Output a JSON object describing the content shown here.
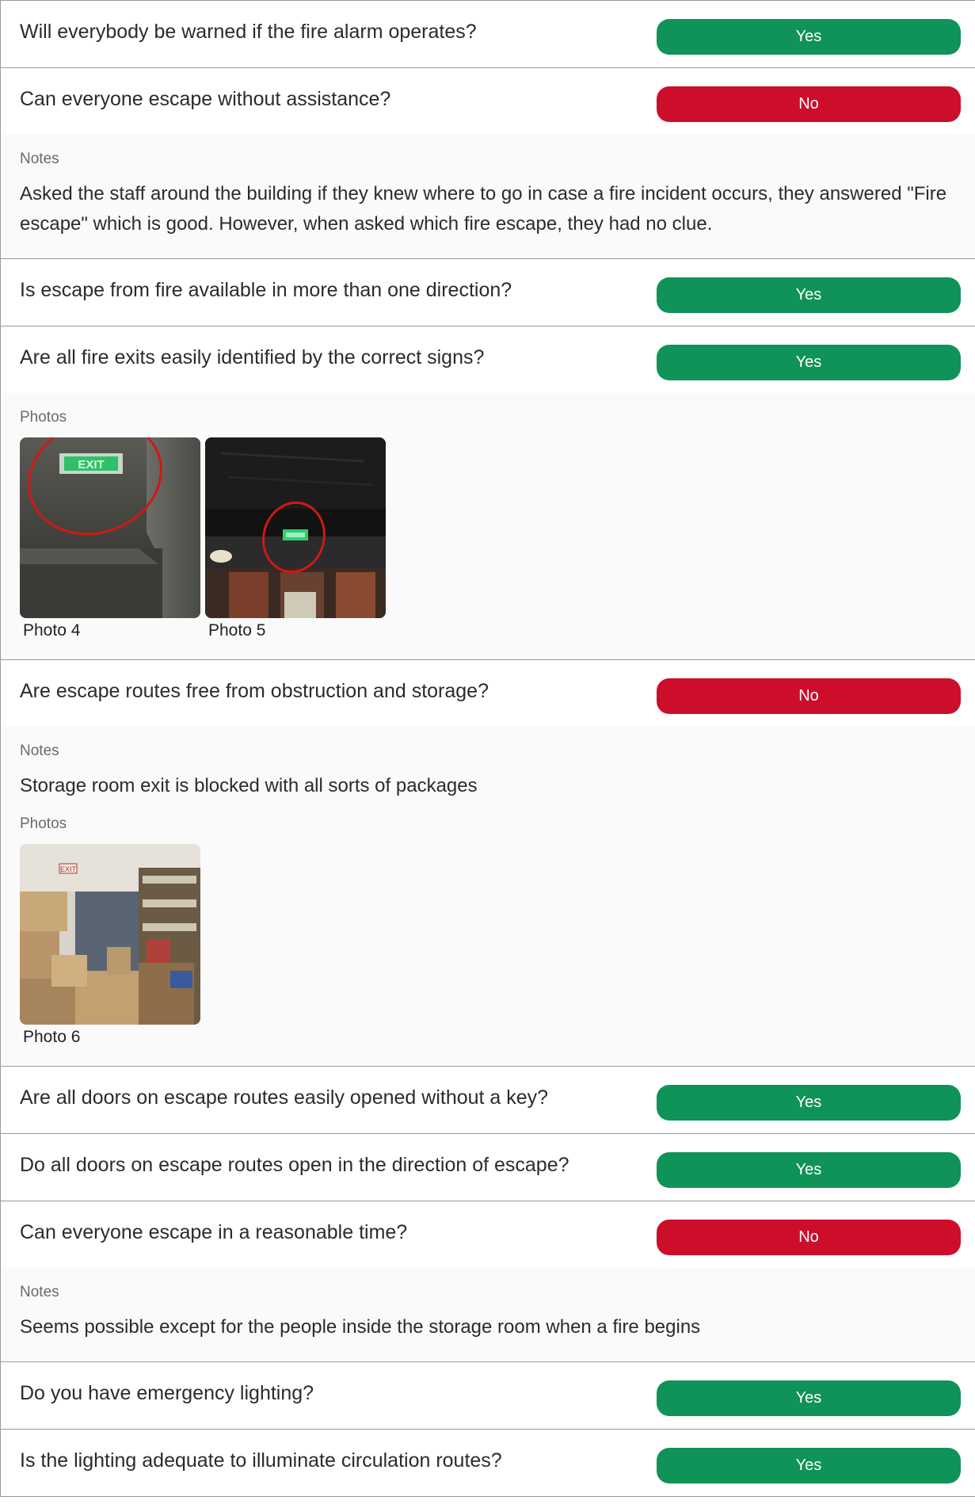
{
  "labels": {
    "notes": "Notes",
    "photos": "Photos"
  },
  "colors": {
    "yes": "#0f9358",
    "no": "#cc0e2b"
  },
  "items": [
    {
      "question": "Will everybody be warned if the fire alarm operates?",
      "answer": "Yes"
    },
    {
      "question": "Can everyone escape without assistance?",
      "answer": "No",
      "notes": "Asked the staff around the building if they knew where to go in case a fire incident occurs, they answered \"Fire escape\" which is good. However, when asked which fire escape, they had no clue."
    },
    {
      "question": "Is escape from fire available in more than one direction?",
      "answer": "Yes"
    },
    {
      "question": "Are all fire exits easily identified by the correct signs?",
      "answer": "Yes",
      "photos": [
        {
          "caption": "Photo 4",
          "sign_text": "EXIT"
        },
        {
          "caption": "Photo 5",
          "sign_text": ""
        }
      ]
    },
    {
      "question": "Are escape routes free from obstruction and storage?",
      "answer": "No",
      "notes": "Storage room exit is blocked with all sorts of packages",
      "photos": [
        {
          "caption": "Photo 6",
          "sign_text": "EXIT"
        }
      ]
    },
    {
      "question": "Are all doors on escape routes easily opened without a key?",
      "answer": "Yes"
    },
    {
      "question": "Do all doors on escape routes open in the direction of escape?",
      "answer": "Yes"
    },
    {
      "question": "Can everyone escape in a reasonable time?",
      "answer": "No",
      "notes": "Seems possible except for the people inside the storage room when a fire begins"
    },
    {
      "question": "Do you have emergency lighting?",
      "answer": "Yes"
    },
    {
      "question": "Is the lighting adequate to illuminate circulation routes?",
      "answer": "Yes"
    }
  ]
}
